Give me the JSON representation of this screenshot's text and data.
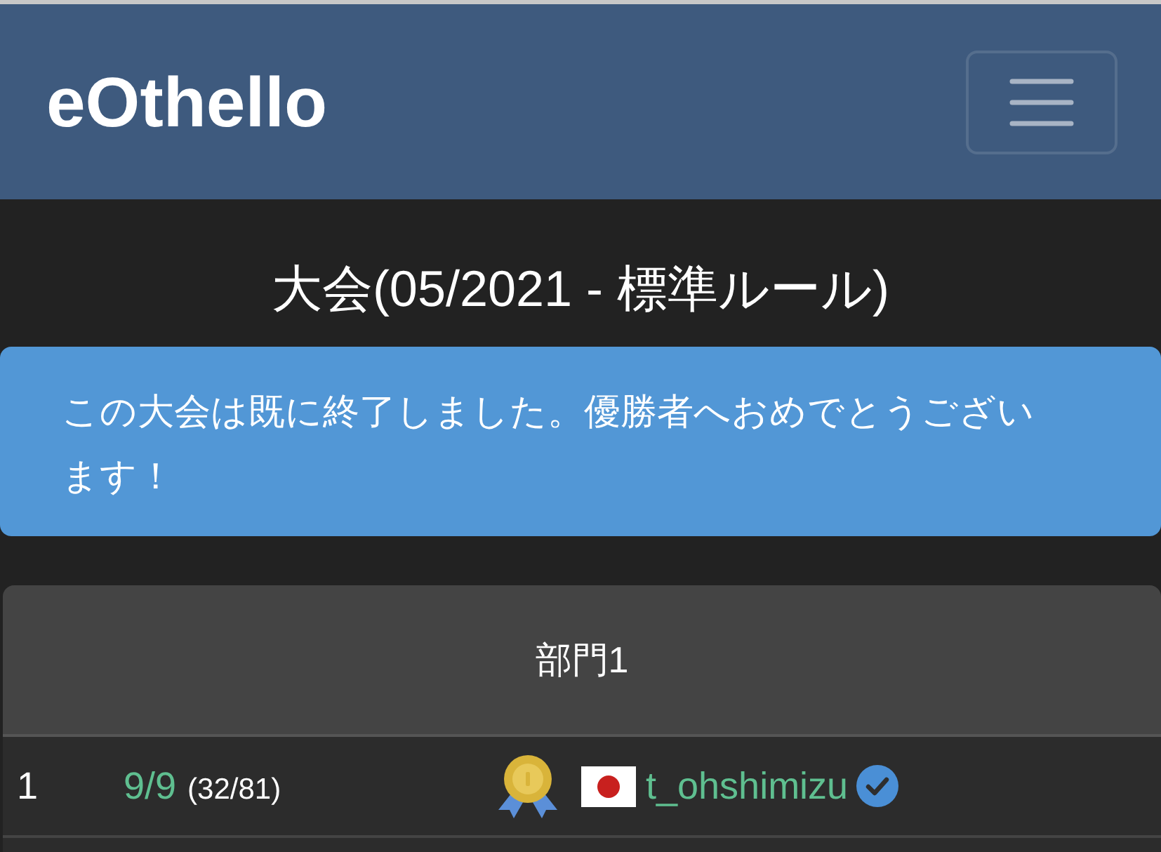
{
  "navbar": {
    "brand": "eOthello"
  },
  "title": "大会(05/2021 - 標準ルール)",
  "alert": {
    "text": "この大会は既に終了しました。優勝者へおめでとうございます！"
  },
  "division": {
    "title": "部門1",
    "rows": [
      {
        "rank": "1",
        "score": "9/9",
        "detail": "(32/81)",
        "medal": true,
        "player": "t_ohshimizu",
        "verified": true
      }
    ]
  }
}
